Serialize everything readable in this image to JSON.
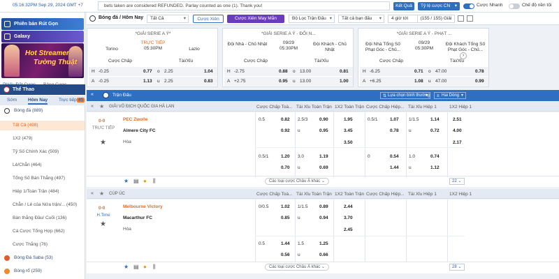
{
  "topbar": {
    "time": "05:16:32PM Sep 29, 2024 GMT +7",
    "notice": "bets taken are considered REFUNDED. Parlay counted as one (1). Thank you!",
    "results_label": "Kết Quả",
    "odds_label": "Tỷ lệ cược CN",
    "quick_bet_label": "Cược Nhanh",
    "dark_mode_label": "Chế độ nền tối"
  },
  "sidebar": {
    "promo1": "Phiên bản Rút Gọn",
    "promo2": "Galaxy",
    "banner_line1": "Hot Streamer",
    "banner_line2": "Tường Thuật",
    "tabs": [
      "Phiếu Đặt Cược",
      "Bảng Cược"
    ],
    "sports_header": "Thể Thao",
    "periods": [
      "Sớm",
      "Hôm Nay",
      "Trực tiếp"
    ],
    "periods_badge": "45",
    "items": [
      {
        "label": "Bóng đá (889)"
      },
      {
        "label": "Tất Cả (498)"
      },
      {
        "label": "1X2 (479)"
      },
      {
        "label": "Tỷ Số Chính Xác (509)"
      },
      {
        "label": "Lẻ/Chẵn (464)"
      },
      {
        "label": "Tổng Số Bàn Thắng (497)"
      },
      {
        "label": "Hiệp 1/Toàn Trận (484)"
      },
      {
        "label": "Chẵn / Lẻ của Nửa trận/... (450)"
      },
      {
        "label": "Bàn thắng Đầu/ Cuối (136)"
      },
      {
        "label": "Cá Cược Tổng Hợp (662)"
      },
      {
        "label": "Cược Thắng (76)"
      },
      {
        "label": "Bóng Đá Saba (53)"
      },
      {
        "label": "Bóng rổ (259)"
      }
    ]
  },
  "featured": {
    "title": "Bóng đá / Hôm Nay",
    "filter_all": "Tất Cả",
    "xien_label": "Cược Xiên",
    "xien_lucky_label": "Cược Xiên May Mắn",
    "filter_match": "Bộ Lọc Trận Đấu",
    "filter_days": "Tất cả bạn đấu",
    "filter_time": "4 giờ tới",
    "count": "(155 / 155) Giải",
    "cards": [
      {
        "league": "*GIẢI SERIE A Ý*",
        "home": "Torino",
        "away": "Lazio",
        "status": "TRỰC TIẾP",
        "time": "05:30PM",
        "mkt1": "Cược Chấp",
        "mkt2": "Tài/Xỉu",
        "row1": {
          "l1": "H",
          "v1": "-0.25",
          "o1": "0.77",
          "l2": "o",
          "v2": "2.25",
          "o2": "1.04"
        },
        "row2": {
          "l1": "A",
          "v1": "-0.25",
          "o1": "1.13",
          "l2": "u",
          "v2": "2.25",
          "o2": "0.83"
        }
      },
      {
        "league": "*GIẢI SERIE A Ý - ĐỐI N...",
        "home": "Đội Nhà - Chủ Nhật",
        "away": "Đội Khách - Chủ Nhật",
        "status": "09/29",
        "time": "05:30PM",
        "mkt1": "Cược Chấp",
        "mkt2": "Tài/Xỉu",
        "row1": {
          "l1": "H",
          "v1": "-2.75",
          "o1": "0.88",
          "l2": "o",
          "v2": "13.00",
          "o2": "0.81"
        },
        "row2": {
          "l1": "A",
          "v1": "+2.75",
          "o1": "0.95",
          "l2": "u",
          "v2": "13.00",
          "o2": "1.00"
        }
      },
      {
        "league": "*GIẢI SERIE A Ý - PHẠT ...",
        "home": "Đội Nhà Tổng Số Phạt Góc - Chủ...",
        "away": "Đội Khách Tổng Số Phạt Góc - Chủ...",
        "status": "09/29",
        "time": "05:30PM",
        "mkt1": "Cược Chấp",
        "mkt2": "Tài/Xỉu",
        "row1": {
          "l1": "H",
          "v1": "-6.25",
          "o1": "0.71",
          "l2": "o",
          "v2": "47.00",
          "o2": "0.78"
        },
        "row2": {
          "l1": "A",
          "v1": "+6.25",
          "o1": "1.08",
          "l2": "u",
          "v2": "47.00",
          "o2": "0.99"
        }
      }
    ]
  },
  "table": {
    "title": "Trận Đấu",
    "sort_label": "Lựa chọn bình thường",
    "single_label": "Hai Dòng",
    "headers": [
      "Cược Chấp Toà...",
      "Tài Xỉu Toàn Trận",
      "1X2 Toàn Trận",
      "Cược Chấp Hiệp...",
      "Tài Xỉu Hiệp 1",
      "1X2 Hiệp 1"
    ],
    "more_label": "Các loại cược Châu Á khác",
    "leagues": [
      {
        "name": "GIẢI VÔ ĐỊCH QUỐC GIA HÀ LAN",
        "score": "0-0",
        "status": "TRỰC TIẾP",
        "home": "PEC Zwolle",
        "away": "Almere City FC",
        "draw": "Hòa",
        "count": "22",
        "r1": [
          "0.5",
          "0.82",
          "2.5/3",
          "0.90",
          "1.95",
          "0.5/1",
          "1.07",
          "1/1.5",
          "1.14",
          "2.51"
        ],
        "r2": [
          "",
          "0.92",
          "u",
          "0.95",
          "3.45",
          "",
          "0.78",
          "u",
          "0.72",
          "4.00"
        ],
        "r3": [
          "2.17",
          "3.50"
        ],
        "r4": [
          "0.5/1",
          "1.20",
          "3.0",
          "1.19",
          "",
          "0",
          "0.54",
          "1.0",
          "0.74",
          ""
        ],
        "r5": [
          "",
          "0.70",
          "u",
          "0.69",
          "",
          "",
          "1.44",
          "u",
          "1.12",
          ""
        ]
      },
      {
        "name": "CÚP ÚC",
        "score": "0-0",
        "status": "H.Time",
        "home": "Melbourne Victory",
        "away": "Macarthur FC",
        "draw": "Hòa",
        "count": "28",
        "r1": [
          "0/0.5",
          "1.02",
          "1/1.5",
          "0.89",
          "2.44"
        ],
        "r2": [
          "",
          "0.85",
          "u",
          "0.94",
          "3.70"
        ],
        "r3": [
          "2.45"
        ],
        "r4": [
          "0.5",
          "1.44",
          "1.5",
          "1.25",
          ""
        ],
        "r5": [
          "",
          "0.56",
          "u",
          "0.66",
          ""
        ]
      }
    ]
  },
  "colors": {
    "primary": "#2f6fbf",
    "navy": "#244a87",
    "accent_orange": "#e06a1f",
    "lucky_purple": "#6a3cbc"
  }
}
